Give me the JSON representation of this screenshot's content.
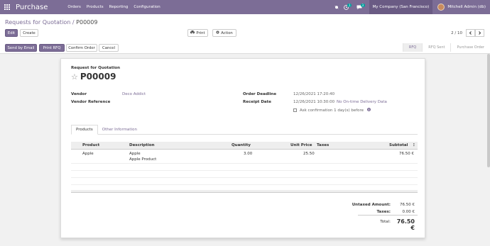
{
  "navbar": {
    "brand": "Purchase",
    "menu": [
      "Orders",
      "Products",
      "Reporting",
      "Configuration"
    ],
    "chat_badge": "3",
    "activity_badge": "1",
    "company": "My Company (San Francisco)",
    "user": "Mitchell Admin (db)"
  },
  "breadcrumb": {
    "parent": "Requests for Quotation",
    "separator": " / ",
    "current": "P00009"
  },
  "buttons": {
    "edit": "Edit",
    "create": "Create",
    "print": "Print",
    "action": "Action",
    "send_by_email": "Send by Email",
    "print_rfq": "Print RFQ",
    "confirm_order": "Confirm Order",
    "cancel": "Cancel"
  },
  "pager": {
    "value": "2 / 10"
  },
  "stages": [
    "RFQ",
    "RFQ Sent",
    "Purchase Order"
  ],
  "form": {
    "doc_type": "Request for Quotation",
    "name": "P00009",
    "vendor_label": "Vendor",
    "vendor_value": "Deco Addict",
    "vendor_ref_label": "Vendor Reference",
    "order_deadline_label": "Order Deadline",
    "order_deadline_value": "12/26/2021 17:20:40",
    "receipt_date_label": "Receipt Date",
    "receipt_date_value": "12/26/2021 10:30:00",
    "ontime_link": "No On-time Delivery Data",
    "ask_confirmation": "Ask confirmation  1  day(s) before"
  },
  "tabs": [
    "Products",
    "Other Information"
  ],
  "table": {
    "headers": [
      "Product",
      "Description",
      "Quantity",
      "Unit Price",
      "Taxes",
      "Subtotal"
    ],
    "rows": [
      {
        "product": "Apple",
        "description_1": "Apple",
        "description_2": "Apple Product",
        "quantity": "3.00",
        "unit_price": "25.50",
        "taxes": "",
        "subtotal": "76.50 €"
      }
    ]
  },
  "totals": {
    "untaxed_label": "Untaxed Amount:",
    "untaxed_value": "76.50 €",
    "taxes_label": "Taxes:",
    "taxes_value": "0.00 €",
    "total_label": "Total:",
    "total_value": "76.50 €"
  },
  "colors": {
    "brand": "#7c6d96",
    "badge": "#00a09d"
  }
}
